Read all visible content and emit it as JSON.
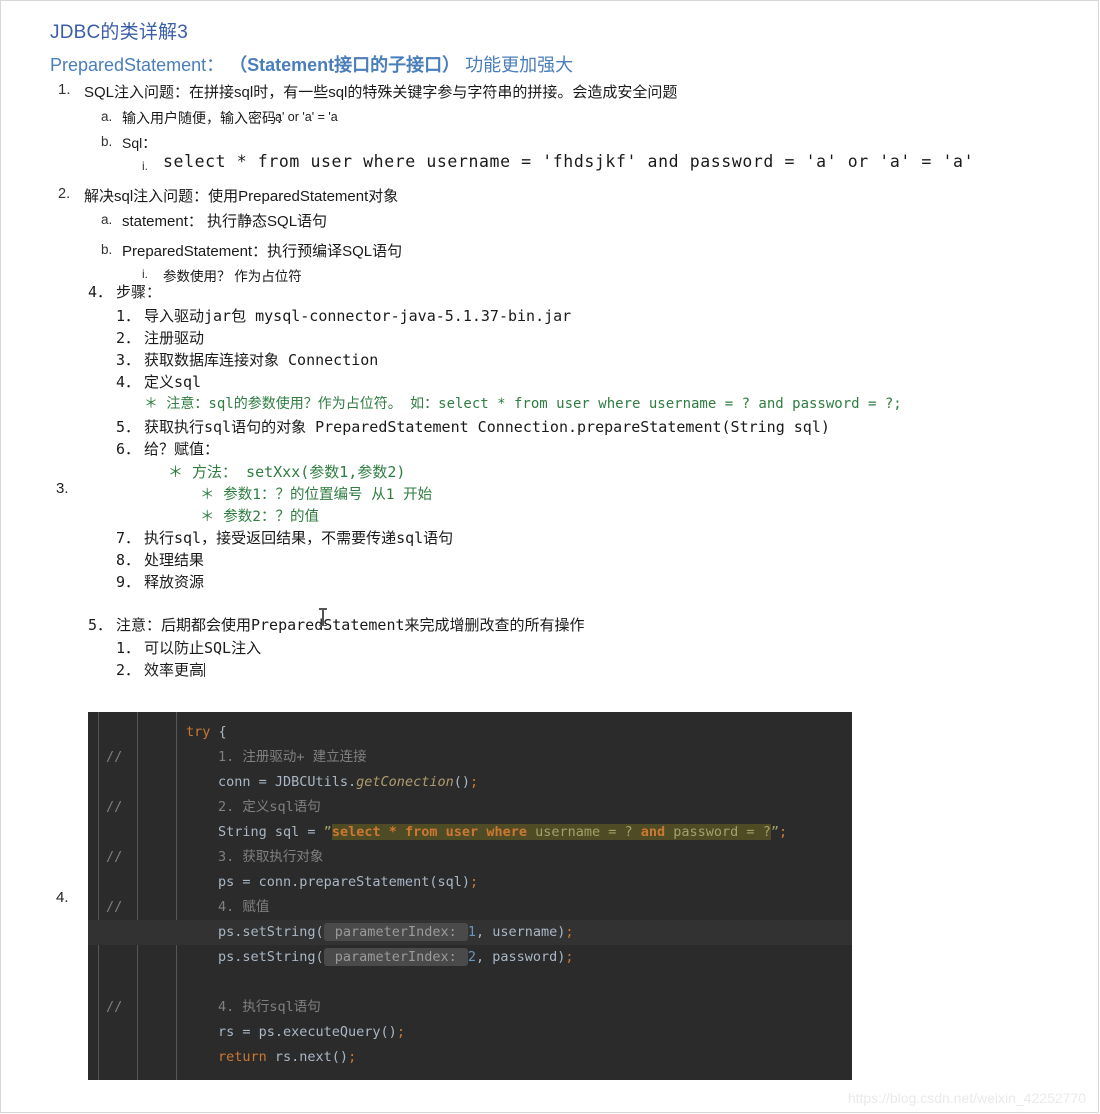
{
  "document": {
    "title": "JDBC的类详解3",
    "subtitle_prefix": "PreparedStatement：",
    "subtitle_bold": "（Statement接口的子接口）",
    "subtitle_suffix": "功能更加强大",
    "watermark": "https://blog.csdn.net/weixin_42252770"
  },
  "outline": {
    "item1_num": "1.",
    "item1": "SQL注入问题：在拼接sql时，有一些sql的特殊关键字参与字符串的拼接。会造成安全问题",
    "item1a_num": "a.",
    "item1a": "输入用户随便，输入密码：",
    "item1a_code": "a' or 'a' = 'a",
    "item1b_num": "b.",
    "item1b": "Sql：",
    "item1bi_num": "i.",
    "item1bi_code": "select * from user where username = 'fhdsjkf' and password = 'a' or 'a' = 'a'",
    "item2_num": "2.",
    "item2": "解决sql注入问题：使用PreparedStatement对象",
    "item2a_num": "a.",
    "item2a": "statement：  执行静态SQL语句",
    "item2b_num": "b.",
    "item2b": "PreparedStatement：执行预编译SQL语句",
    "item2bi_num": "i.",
    "item2bi": "参数使用？ 作为占位符",
    "outer3": "3.",
    "outer4": "4.",
    "step_header_num": "4．",
    "step_header": "步骤：",
    "steps": [
      {
        "num": "1．",
        "text": "导入驱动jar包 mysql-connector-java-5.1.37-bin.jar"
      },
      {
        "num": "2．",
        "text": "注册驱动"
      },
      {
        "num": "3．",
        "text": "获取数据库连接对象 Connection"
      },
      {
        "num": "4．",
        "text": "定义sql"
      }
    ],
    "note_sql_param": "＊ 注意：sql的参数使用？作为占位符。  如：select * from user where username = ? and password = ?;",
    "step5_num": "5．",
    "step5": "获取执行sql语句的对象 PreparedStatement   Connection.prepareStatement(String sql)",
    "step6_num": "6．",
    "step6": "给？赋值：",
    "step6_method": "＊ 方法：  setXxx(参数1,参数2)",
    "step6_p1": "＊ 参数1：？的位置编号 从1 开始",
    "step6_p2": "＊ 参数2：？的值",
    "step7_num": "7．",
    "step7": "执行sql，接受返回结果，不需要传递sql语句",
    "step8_num": "8．",
    "step8": "处理结果",
    "step9_num": "9．",
    "step9": "释放资源",
    "final_num": "5．",
    "final": "注意：后期都会使用PreparedStatement来完成增删改查的所有操作",
    "final1_num": "1．",
    "final1": "可以防止SQL注入",
    "final2_num": "2．",
    "final2": "效率更高"
  },
  "code": {
    "lines": [
      {
        "comment_marker": "",
        "indent": 0,
        "highlight": false,
        "tokens": [
          {
            "t": "try",
            "c": "c-key"
          },
          {
            "t": " {",
            "c": "c-plain"
          }
        ]
      },
      {
        "comment_marker": "//",
        "indent": 1,
        "highlight": false,
        "tokens": [
          {
            "t": "1. 注册驱动+ 建立连接",
            "c": "c-cmt"
          }
        ]
      },
      {
        "comment_marker": "",
        "indent": 1,
        "highlight": false,
        "tokens": [
          {
            "t": "conn = JDBCUtils.",
            "c": "c-plain"
          },
          {
            "t": "getConection",
            "c": "c-meth"
          },
          {
            "t": "()",
            "c": "c-plain"
          },
          {
            "t": ";",
            "c": "c-semi"
          }
        ]
      },
      {
        "comment_marker": "//",
        "indent": 1,
        "highlight": false,
        "tokens": [
          {
            "t": "2. 定义sql语句",
            "c": "c-cmt"
          }
        ]
      },
      {
        "comment_marker": "",
        "indent": 1,
        "highlight": false,
        "sql_string": true,
        "tokens": [
          {
            "t": "String sql = ",
            "c": "c-plain"
          }
        ],
        "string_parts": [
          {
            "t": "”",
            "c": "c-str"
          },
          {
            "t": "select",
            "c": "c-sqlkw",
            "hl": true
          },
          {
            "t": " ",
            "c": "c-str",
            "hl": true
          },
          {
            "t": "*",
            "c": "c-sqlkw",
            "hl": true
          },
          {
            "t": " ",
            "c": "c-str",
            "hl": true
          },
          {
            "t": "from",
            "c": "c-sqlkw",
            "hl": true
          },
          {
            "t": " ",
            "c": "c-str",
            "hl": true
          },
          {
            "t": "user",
            "c": "c-sqlkw",
            "hl": true
          },
          {
            "t": " ",
            "c": "c-str",
            "hl": true
          },
          {
            "t": "where",
            "c": "c-sqlkw",
            "hl": true
          },
          {
            "t": " username = ? ",
            "c": "c-str",
            "hl": true
          },
          {
            "t": "and",
            "c": "c-sqlkw",
            "hl": true
          },
          {
            "t": " password = ?",
            "c": "c-str",
            "hl": true
          },
          {
            "t": "”",
            "c": "c-str"
          },
          {
            "t": ";",
            "c": "c-semi"
          }
        ]
      },
      {
        "comment_marker": "//",
        "indent": 1,
        "highlight": false,
        "tokens": [
          {
            "t": "3. 获取执行对象",
            "c": "c-cmt"
          }
        ]
      },
      {
        "comment_marker": "",
        "indent": 1,
        "highlight": false,
        "tokens": [
          {
            "t": "ps = conn.prepareStatement(sql)",
            "c": "c-plain"
          },
          {
            "t": ";",
            "c": "c-semi"
          }
        ]
      },
      {
        "comment_marker": "//",
        "indent": 1,
        "highlight": false,
        "tokens": [
          {
            "t": "4. 赋值",
            "c": "c-cmt"
          }
        ]
      },
      {
        "comment_marker": "",
        "indent": 1,
        "highlight": true,
        "tokens": [
          {
            "t": "ps.setString(",
            "c": "c-plain"
          },
          {
            "t": " parameterIndex: ",
            "c": "param-hint"
          },
          {
            "t": "1",
            "c": "c-num"
          },
          {
            "t": ", username)",
            "c": "c-plain"
          },
          {
            "t": ";",
            "c": "c-semi"
          }
        ]
      },
      {
        "comment_marker": "",
        "indent": 1,
        "highlight": false,
        "tokens": [
          {
            "t": "ps.setString(",
            "c": "c-plain"
          },
          {
            "t": " parameterIndex: ",
            "c": "param-hint"
          },
          {
            "t": "2",
            "c": "c-num"
          },
          {
            "t": ", password)",
            "c": "c-plain"
          },
          {
            "t": ";",
            "c": "c-semi"
          }
        ]
      },
      {
        "comment_marker": "",
        "indent": 1,
        "highlight": false,
        "tokens": []
      },
      {
        "comment_marker": "//",
        "indent": 1,
        "highlight": false,
        "tokens": [
          {
            "t": "4. 执行sql语句",
            "c": "c-cmt"
          }
        ]
      },
      {
        "comment_marker": "",
        "indent": 1,
        "highlight": false,
        "tokens": [
          {
            "t": "rs = ps.executeQuery()",
            "c": "c-plain"
          },
          {
            "t": ";",
            "c": "c-semi"
          }
        ]
      },
      {
        "comment_marker": "",
        "indent": 1,
        "highlight": false,
        "tokens": [
          {
            "t": "return",
            "c": "c-key"
          },
          {
            "t": " rs.next()",
            "c": "c-plain"
          },
          {
            "t": ";",
            "c": "c-semi"
          }
        ]
      }
    ]
  }
}
